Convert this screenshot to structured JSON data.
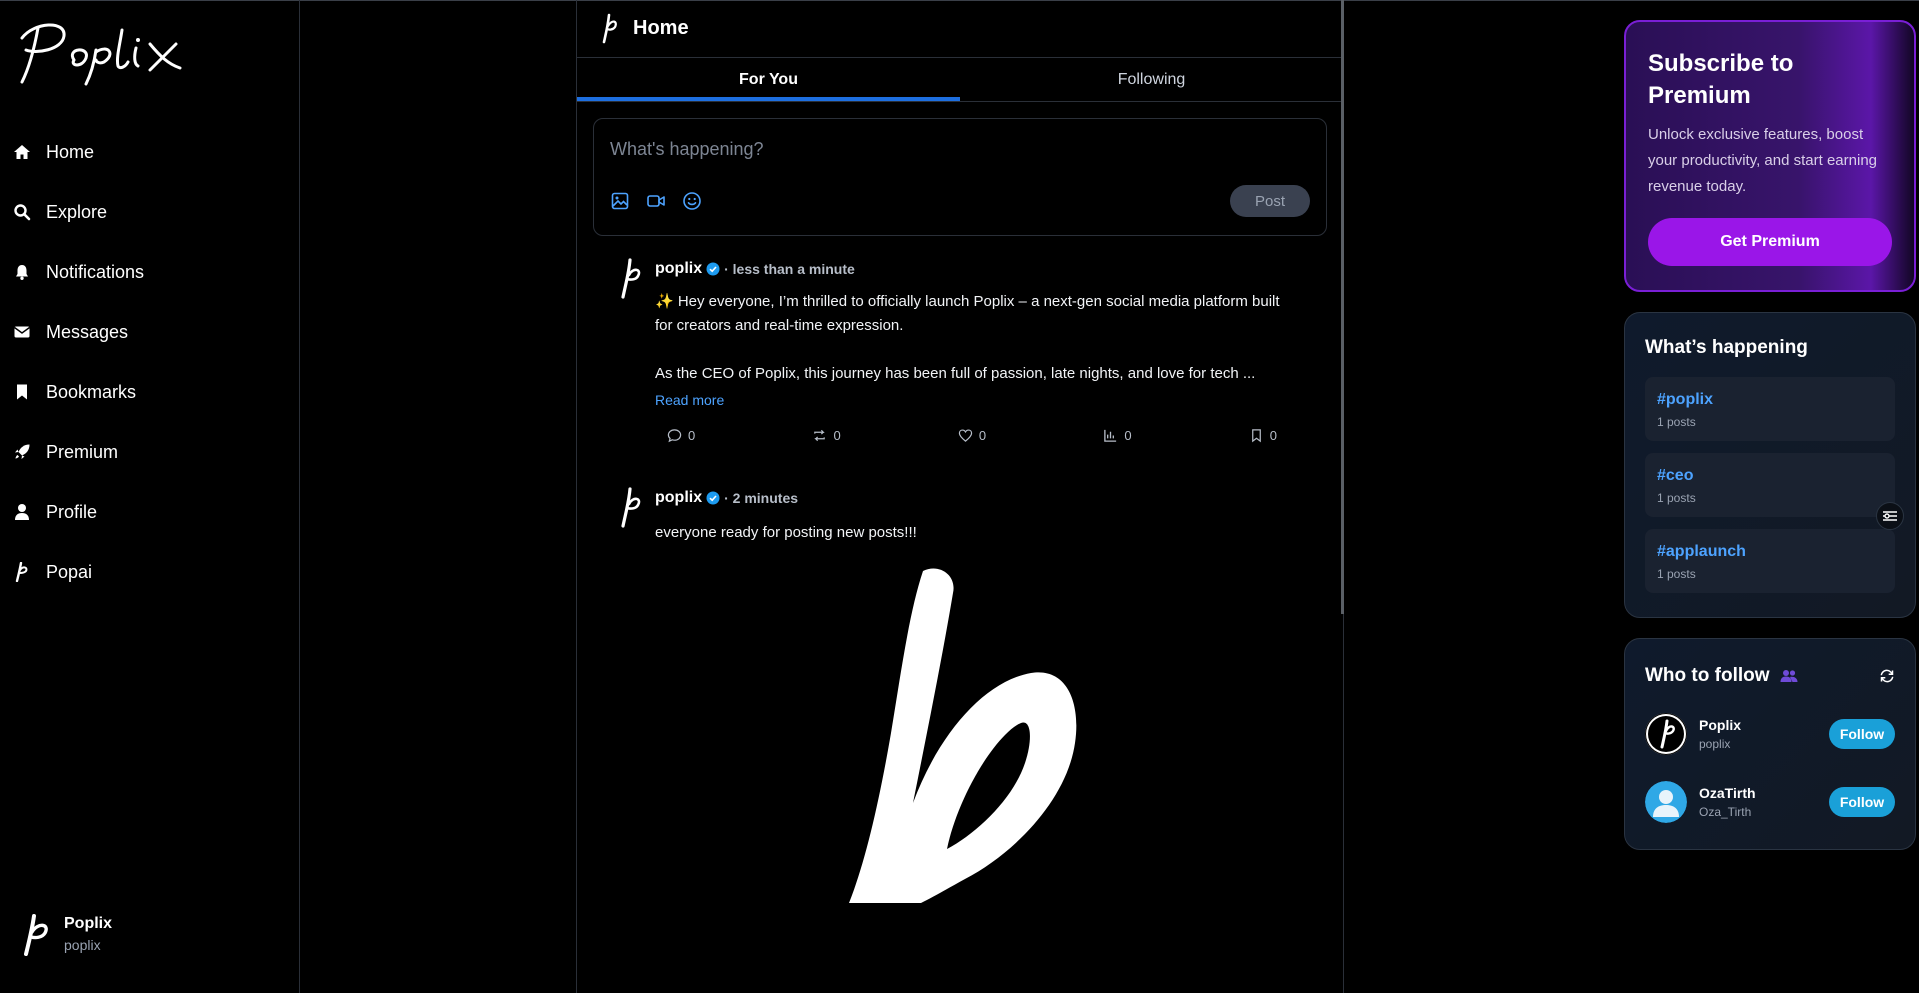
{
  "sidebar": {
    "logo_text": "Poplix",
    "nav": [
      {
        "label": "Home",
        "icon": "home-icon"
      },
      {
        "label": "Explore",
        "icon": "search-icon"
      },
      {
        "label": "Notifications",
        "icon": "bell-icon"
      },
      {
        "label": "Messages",
        "icon": "envelope-icon"
      },
      {
        "label": "Bookmarks",
        "icon": "bookmark-icon"
      },
      {
        "label": "Premium",
        "icon": "rocket-icon"
      },
      {
        "label": "Profile",
        "icon": "user-icon"
      },
      {
        "label": "Popai",
        "icon": "poplix-p-icon"
      }
    ],
    "account": {
      "name": "Poplix",
      "handle": "poplix"
    }
  },
  "feed": {
    "title": "Home",
    "tabs": [
      {
        "label": "For You",
        "active": true
      },
      {
        "label": "Following",
        "active": false
      }
    ],
    "composer": {
      "placeholder": "What's happening?",
      "post_label": "Post"
    },
    "posts": [
      {
        "author": "poplix",
        "time": "· less than a minute",
        "text1": "✨ Hey everyone, I’m thrilled to officially launch Poplix – a next-gen social media platform built for creators and real-time expression.",
        "text2": "As the CEO of Poplix, this journey has been full of passion, late nights, and love for tech ...",
        "read_more": "Read more",
        "counts": {
          "replies": "0",
          "reposts": "0",
          "likes": "0",
          "views": "0",
          "bookmarks": "0"
        }
      },
      {
        "author": "poplix",
        "time": "· 2 minutes",
        "text1": "everyone ready for posting new posts!!!"
      }
    ]
  },
  "premium": {
    "title": "Subscribe to Premium",
    "description": "Unlock exclusive features, boost your productivity, and start earning revenue today.",
    "button": "Get Premium"
  },
  "trends": {
    "title": "What’s happening",
    "items": [
      {
        "tag": "#poplix",
        "count": "1 posts"
      },
      {
        "tag": "#ceo",
        "count": "1 posts"
      },
      {
        "tag": "#applaunch",
        "count": "1 posts"
      }
    ]
  },
  "who_to_follow": {
    "title": "Who to follow",
    "users": [
      {
        "name": "Poplix",
        "handle": "poplix",
        "button": "Follow"
      },
      {
        "name": "OzaTirth",
        "handle": "Oza_Tirth",
        "button": "Follow"
      }
    ]
  },
  "colors": {
    "accent": "#1d6fe0",
    "link": "#4da3ff",
    "premium": "#9a16e8",
    "follow": "#1aa0d8"
  }
}
